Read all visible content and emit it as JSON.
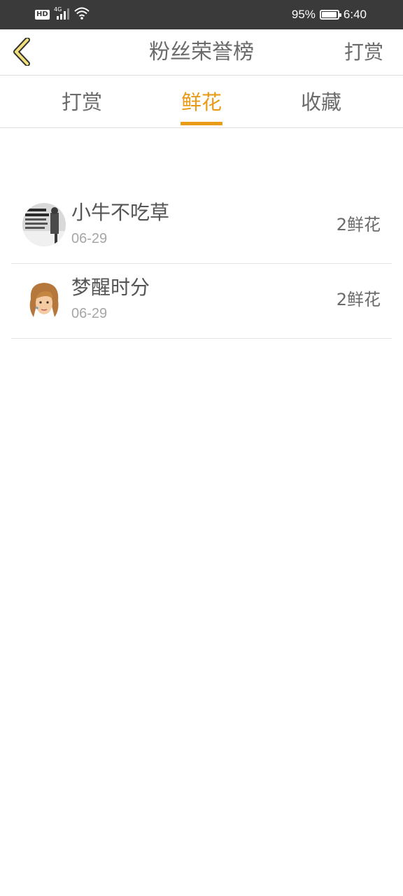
{
  "status_bar": {
    "network_badge": "HD",
    "network_type": "4G",
    "battery_percent": "95%",
    "time": "6:40",
    "battery_level": 0.95
  },
  "header": {
    "title": "粉丝荣誉榜",
    "back_icon": "chevron-left-icon",
    "action_label": "打赏"
  },
  "tabs": [
    {
      "label": "打赏",
      "active": false
    },
    {
      "label": "鲜花",
      "active": true
    },
    {
      "label": "收藏",
      "active": false
    }
  ],
  "list": {
    "items": [
      {
        "name": "小牛不吃草",
        "date": "06-29",
        "amount": "2鲜花",
        "avatar": "avatar-bw-photo"
      },
      {
        "name": "梦醒时分",
        "date": "06-29",
        "amount": "2鲜花",
        "avatar": "avatar-cartoon-girl"
      }
    ]
  },
  "colors": {
    "accent": "#e99b17",
    "status_bar_bg": "#3a3a3a",
    "text_primary": "#555555",
    "text_secondary": "#a6a6a6",
    "back_icon_fill": "#f2e07a"
  }
}
